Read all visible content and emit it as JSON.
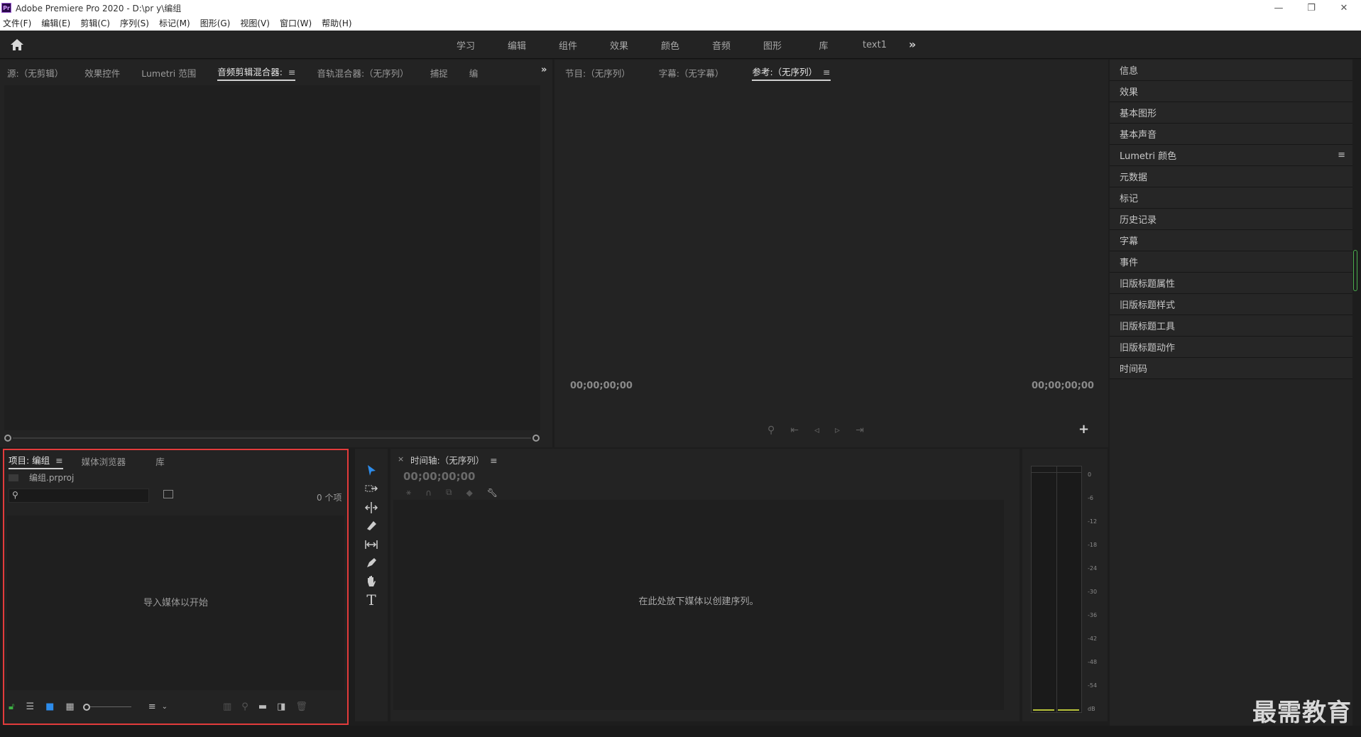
{
  "titlebar": {
    "title": "Adobe Premiere Pro 2020 - D:\\pr y\\编组",
    "logo": "Pr"
  },
  "menu": [
    "文件(F)",
    "编辑(E)",
    "剪辑(C)",
    "序列(S)",
    "标记(M)",
    "图形(G)",
    "视图(V)",
    "窗口(W)",
    "帮助(H)"
  ],
  "workspaces": [
    "学习",
    "编辑",
    "组件",
    "效果",
    "颜色",
    "音频",
    "图形",
    "库",
    "text1"
  ],
  "source_panel": {
    "tabs": [
      "源:（无剪辑）",
      "效果控件",
      "Lumetri 范围",
      "音频剪辑混合器:",
      "音轨混合器:（无序列）",
      "捕捉",
      "编"
    ],
    "active_index": 3
  },
  "program_panel": {
    "tabs": [
      "节目:（无序列）",
      "字幕:（无字幕）",
      "参考:（无序列）"
    ],
    "active_index": 2,
    "timecode_left": "00;00;00;00",
    "timecode_right": "00;00;00;00"
  },
  "right_panel": {
    "items": [
      "信息",
      "效果",
      "基本图形",
      "基本声音",
      "Lumetri 颜色",
      "元数据",
      "标记",
      "历史记录",
      "字幕",
      "事件",
      "旧版标题属性",
      "旧版标题样式",
      "旧版标题工具",
      "旧版标题动作",
      "时间码"
    ]
  },
  "project_panel": {
    "tabs": [
      "项目: 编组",
      "媒体浏览器",
      "库"
    ],
    "file_name": "编组.prproj",
    "item_count": "0 个项",
    "placeholder": "导入媒体以开始"
  },
  "timeline_panel": {
    "title": "时间轴:（无序列）",
    "timecode": "00;00;00;00",
    "placeholder": "在此处放下媒体以创建序列。"
  },
  "audio_meter": {
    "labels": [
      "0",
      "-6",
      "-12",
      "-18",
      "-24",
      "-30",
      "-36",
      "-42",
      "-48",
      "-54",
      "dB"
    ]
  },
  "watermark": "最需教育",
  "colors": {
    "accent": "#2d8ceb",
    "highlight_box": "#e23b3b",
    "panel_bg": "#232323"
  }
}
